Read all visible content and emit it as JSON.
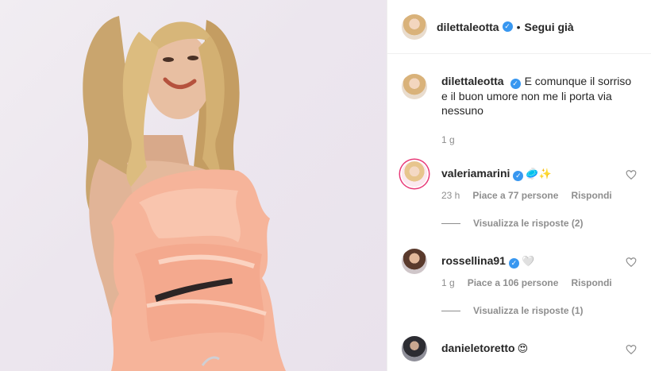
{
  "post": {
    "author": "dilettaleotta",
    "follow_status": "Segui già",
    "separator": "•",
    "caption_text": "E comunque il sorriso e il buon umore non me li porta via nessuno",
    "caption_time": "1 g"
  },
  "comments": [
    {
      "username": "valeriamarini",
      "emoji": "🥏✨",
      "time": "23 h",
      "likes": "Piace a 77 persone",
      "reply": "Rispondi",
      "view_replies": "Visualizza le risposte (2)"
    },
    {
      "username": "rossellina91",
      "emoji": "🤍",
      "time": "1 g",
      "likes": "Piace a 106 persone",
      "reply": "Rispondi",
      "view_replies": "Visualizza le risposte (1)"
    },
    {
      "username": "danieletoretto",
      "emoji": "😍"
    }
  ],
  "icons": {
    "verified": "verified-badge-icon",
    "heart": "heart-outline-icon"
  },
  "colors": {
    "verified_blue": "#3897f0",
    "text": "#262626",
    "muted": "#8e8e8e",
    "dress_peach": "#f6b49a"
  }
}
